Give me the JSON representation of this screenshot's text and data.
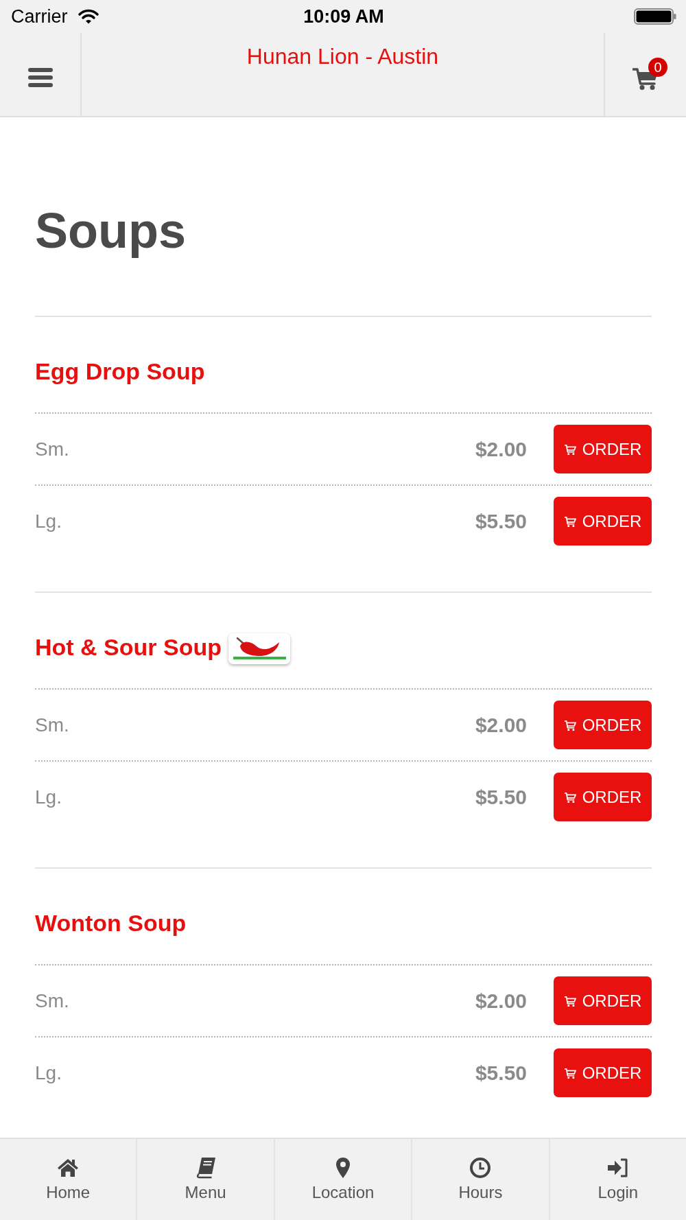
{
  "status_bar": {
    "carrier": "Carrier",
    "time": "10:09 AM"
  },
  "header": {
    "title": "Hunan Lion - Austin",
    "cart_count": "0"
  },
  "page": {
    "title": "Soups"
  },
  "items": [
    {
      "name": "Egg Drop Soup",
      "spicy": false,
      "sizes": [
        {
          "label": "Sm.",
          "price": "$2.00",
          "button": "ORDER"
        },
        {
          "label": "Lg.",
          "price": "$5.50",
          "button": "ORDER"
        }
      ]
    },
    {
      "name": "Hot & Sour Soup",
      "spicy": true,
      "sizes": [
        {
          "label": "Sm.",
          "price": "$2.00",
          "button": "ORDER"
        },
        {
          "label": "Lg.",
          "price": "$5.50",
          "button": "ORDER"
        }
      ]
    },
    {
      "name": "Wonton Soup",
      "spicy": false,
      "sizes": [
        {
          "label": "Sm.",
          "price": "$2.00",
          "button": "ORDER"
        },
        {
          "label": "Lg.",
          "price": "$5.50",
          "button": "ORDER"
        }
      ]
    }
  ],
  "bottom_nav": [
    {
      "label": "Home"
    },
    {
      "label": "Menu"
    },
    {
      "label": "Location"
    },
    {
      "label": "Hours"
    },
    {
      "label": "Login"
    }
  ]
}
